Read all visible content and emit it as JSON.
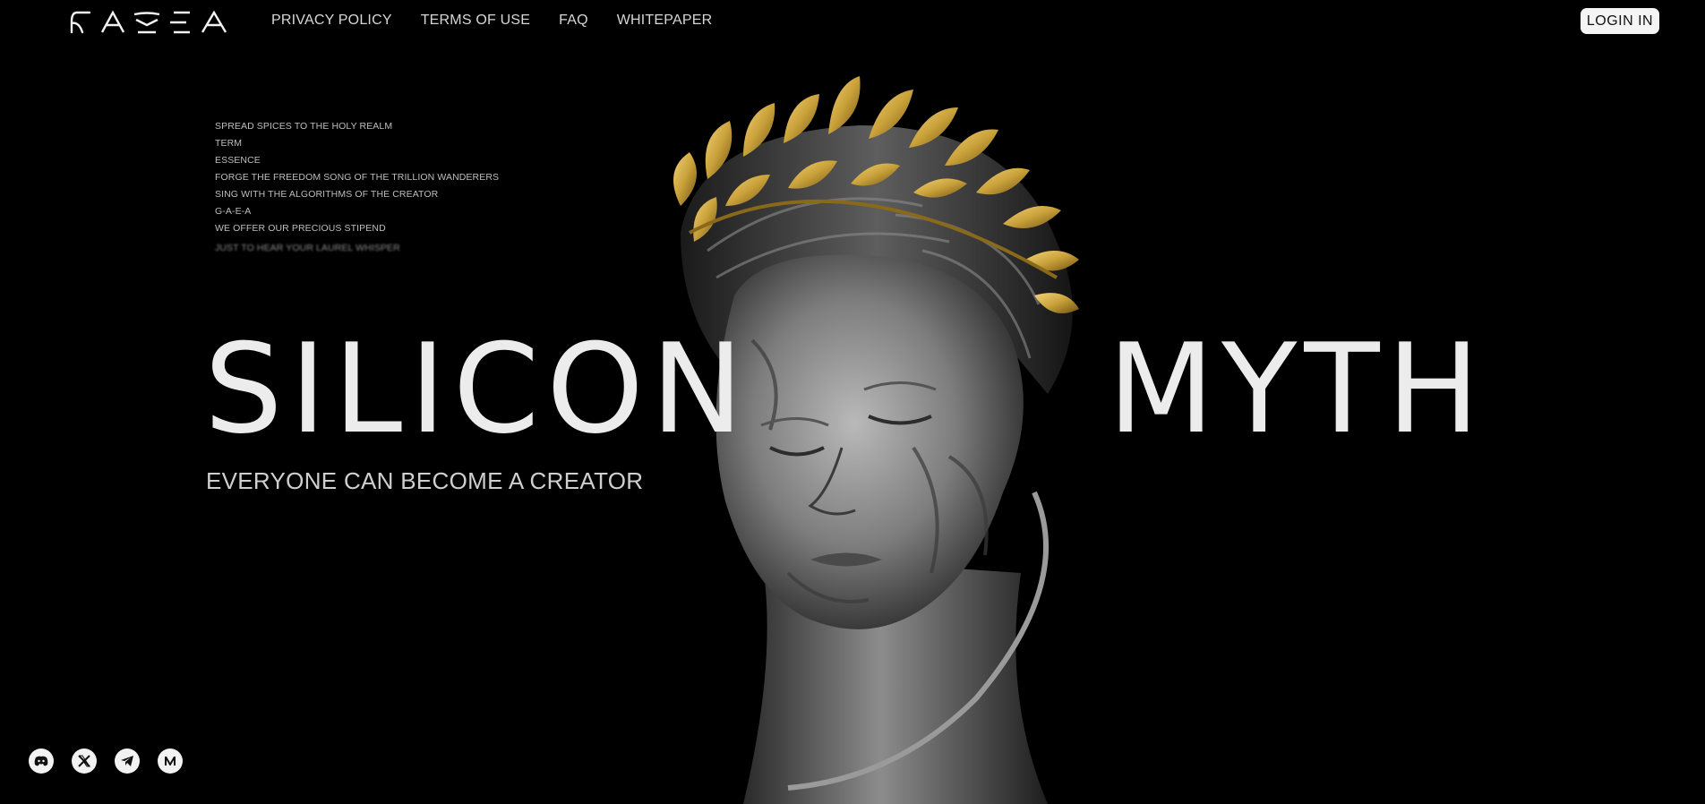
{
  "header": {
    "logo_text": "GAEA",
    "nav": [
      {
        "label": "PRIVACY POLICY"
      },
      {
        "label": "TERMS OF USE"
      },
      {
        "label": "FAQ"
      },
      {
        "label": "WHITEPAPER"
      }
    ],
    "login_label": "LOGIN IN"
  },
  "poem": {
    "lines": [
      "SPREAD SPICES TO THE HOLY REALM",
      "TERM",
      "ESSENCE",
      "FORGE THE FREEDOM SONG OF THE TRILLION WANDERERS",
      "SING WITH THE ALGORITHMS OF THE CREATOR",
      "G-A-E-A",
      "WE OFFER OUR PRECIOUS STIPEND",
      "JUST TO HEAR YOUR LAUREL WHISPER"
    ]
  },
  "hero": {
    "word_left": "SILICON",
    "word_right": "MYTH",
    "tagline": "EVERYONE CAN BECOME A CREATOR"
  },
  "socials": [
    {
      "icon": "discord-icon"
    },
    {
      "icon": "x-icon"
    },
    {
      "icon": "telegram-icon"
    },
    {
      "icon": "medium-icon"
    }
  ],
  "colors": {
    "background": "#000000",
    "text": "#e8e8e8",
    "gold": "#c9a13a",
    "button_bg": "#f4f4f4"
  }
}
